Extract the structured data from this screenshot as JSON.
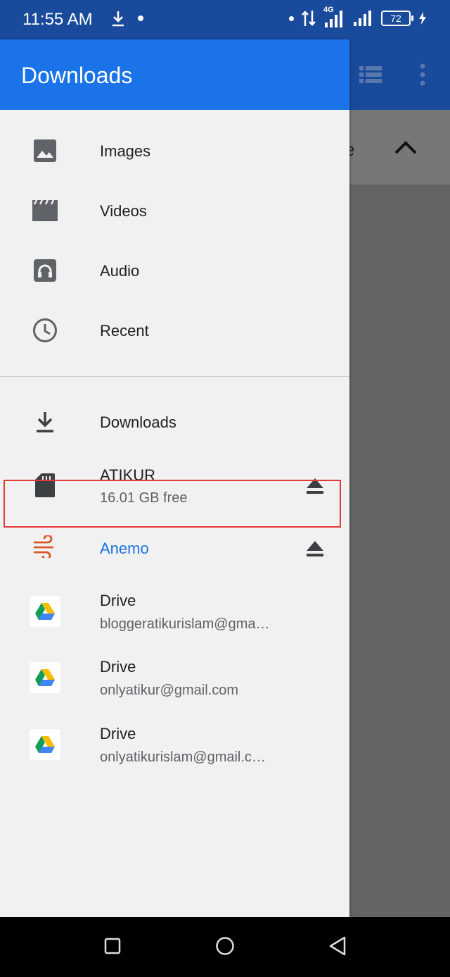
{
  "status_bar": {
    "time": "11:55 AM",
    "network": "4G",
    "battery": "72"
  },
  "drawer": {
    "title": "Downloads",
    "categories": [
      {
        "label": "Images",
        "icon": "image-icon"
      },
      {
        "label": "Videos",
        "icon": "movie-icon"
      },
      {
        "label": "Audio",
        "icon": "headphones-icon"
      },
      {
        "label": "Recent",
        "icon": "clock-icon"
      }
    ],
    "locations": [
      {
        "label": "Downloads",
        "icon": "download-icon"
      },
      {
        "label": "ATIKUR",
        "sublabel": "16.01 GB free",
        "icon": "sd-card-icon"
      },
      {
        "label": "Anemo",
        "icon": "wind-icon"
      },
      {
        "label": "Drive",
        "sublabel": "bloggeratikurislam@gma…",
        "icon": "google-drive-icon"
      },
      {
        "label": "Drive",
        "sublabel": "onlyatikur@gmail.com",
        "icon": "google-drive-icon"
      },
      {
        "label": "Drive",
        "sublabel": "onlyatikurislam@gmail.c…",
        "icon": "google-drive-icon"
      }
    ]
  },
  "background": {
    "partial_text": "e"
  },
  "colors": {
    "drawer_header": "#1a73e8",
    "status_bar": "#1a4a9c",
    "selected_text": "#1a73e8",
    "anemo_icon": "#d9572b",
    "highlight_border": "#e53935"
  }
}
